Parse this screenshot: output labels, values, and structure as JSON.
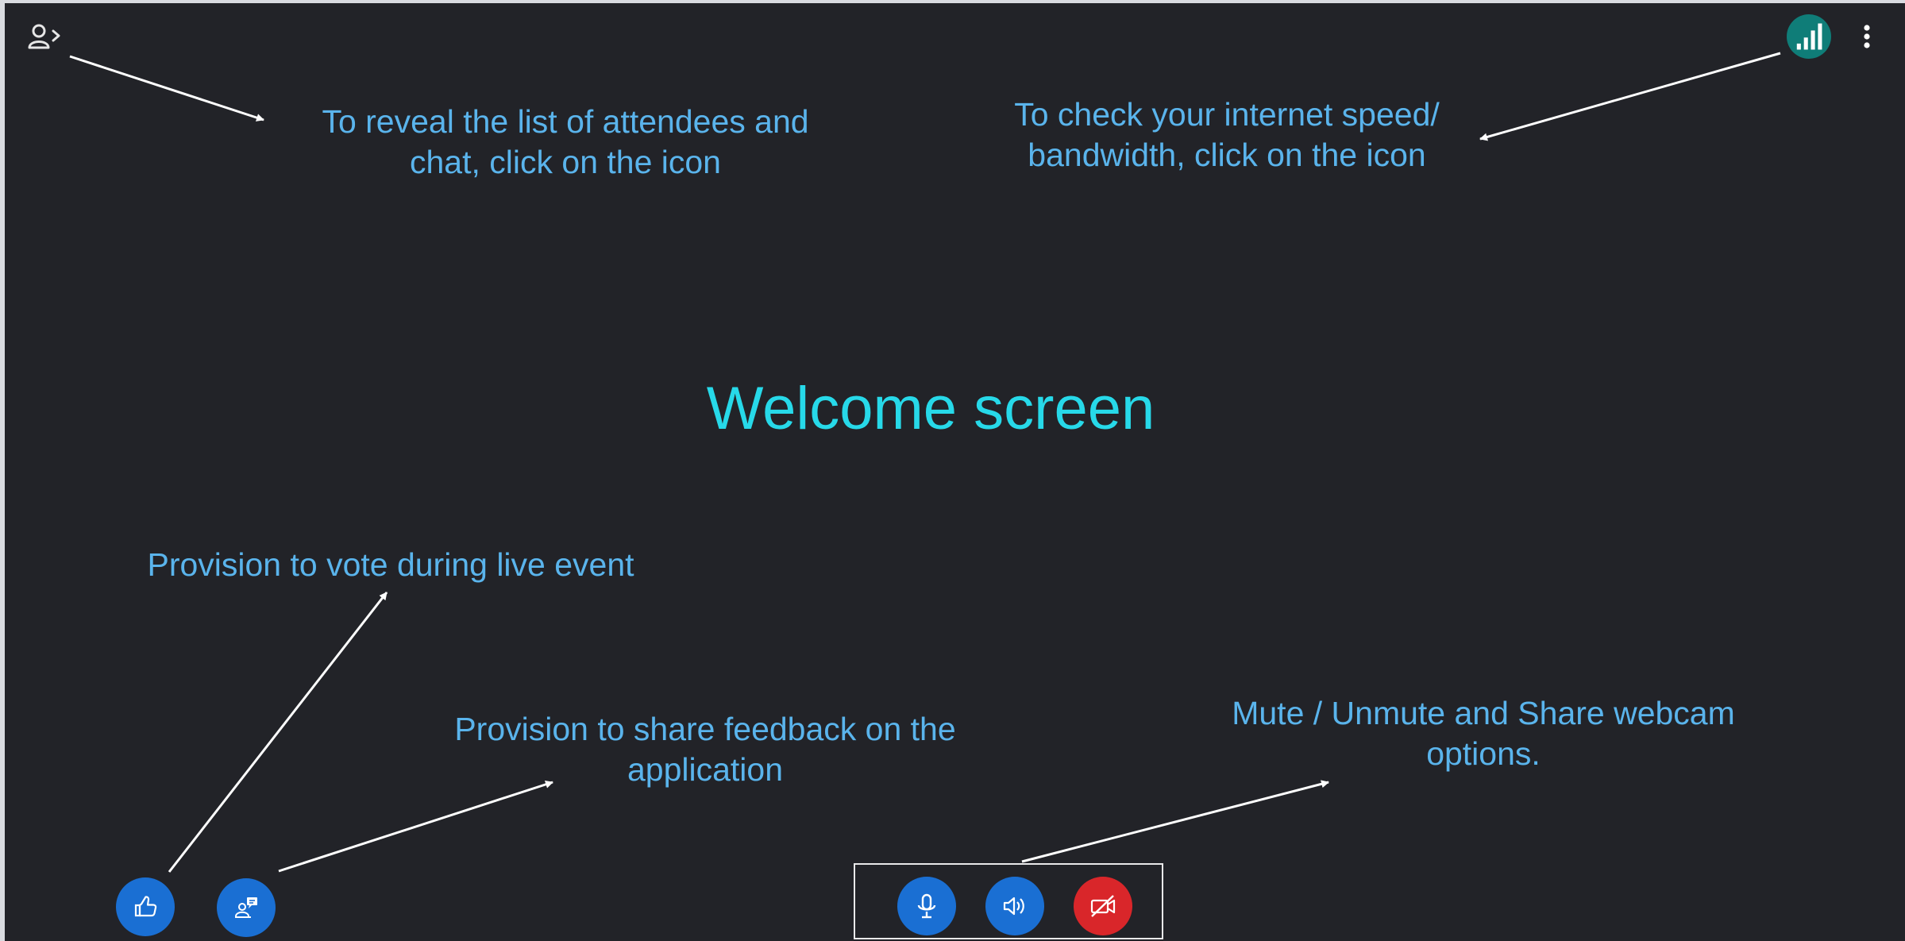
{
  "welcome_title": "Welcome screen",
  "annotations": {
    "attendees": [
      "To reveal the list of attendees and",
      "chat, click on the icon"
    ],
    "speed": [
      "To check your internet speed/",
      "bandwidth, click on the icon"
    ],
    "vote": [
      "Provision to vote during live event"
    ],
    "feedback": [
      "Provision to share feedback on the",
      "application"
    ],
    "media": [
      "Mute / Unmute and Share webcam",
      "options."
    ]
  },
  "icons": {
    "attendees_toggle": "user-chevron-icon",
    "network_speed": "signal-bars-icon",
    "more_menu": "more-vertical-icon",
    "vote": "thumbs-up-icon",
    "feedback": "feedback-icon",
    "microphone": "microphone-icon",
    "speaker": "speaker-icon",
    "webcam": "video-off-icon"
  },
  "colors": {
    "background": "#222328",
    "annotation_text": "#5ab4ec",
    "welcome_text": "#27d9e9",
    "button_blue": "#1a6fd3",
    "button_red": "#d9262a",
    "button_teal": "#0f7d78",
    "arrow": "#ffffff"
  }
}
